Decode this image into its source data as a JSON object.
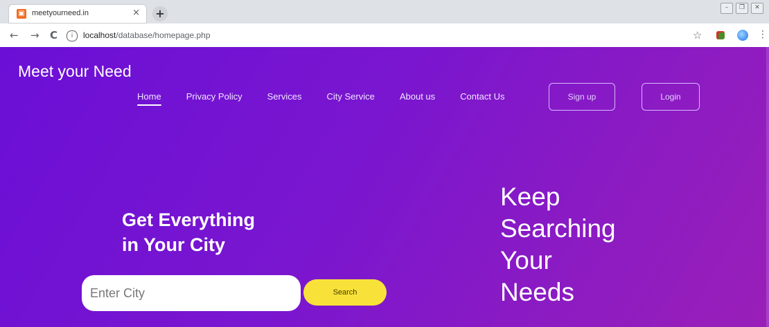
{
  "browser": {
    "tab_title": "meetyourneed.in",
    "tab_close": "×",
    "new_tab": "+",
    "url_host": "localhost",
    "url_path": "/database/homepage.php",
    "nav_back": "←",
    "nav_forward": "→",
    "nav_reload": "C",
    "info_icon": "i",
    "star": "☆",
    "menu": "⋮",
    "win_min": "–",
    "win_restore": "❐",
    "win_close": "✕"
  },
  "site": {
    "brand": "Meet your Need",
    "nav": [
      {
        "label": "Home",
        "active": true
      },
      {
        "label": "Privacy Policy"
      },
      {
        "label": "Services"
      },
      {
        "label": "City Service"
      },
      {
        "label": "About us"
      },
      {
        "label": "Contact Us"
      }
    ],
    "signup_label": "Sign up",
    "login_label": "Login"
  },
  "hero": {
    "headline_line1": "Get Everything",
    "headline_line2": "in Your City",
    "city_placeholder": "Enter City",
    "search_label": "Search",
    "tagline_lines": [
      "Keep",
      "Searching",
      "Your",
      "Needs"
    ]
  },
  "colors": {
    "gradient_start": "#6b0fd6",
    "gradient_end": "#9a1fb8",
    "search_button": "#f8e23a"
  }
}
